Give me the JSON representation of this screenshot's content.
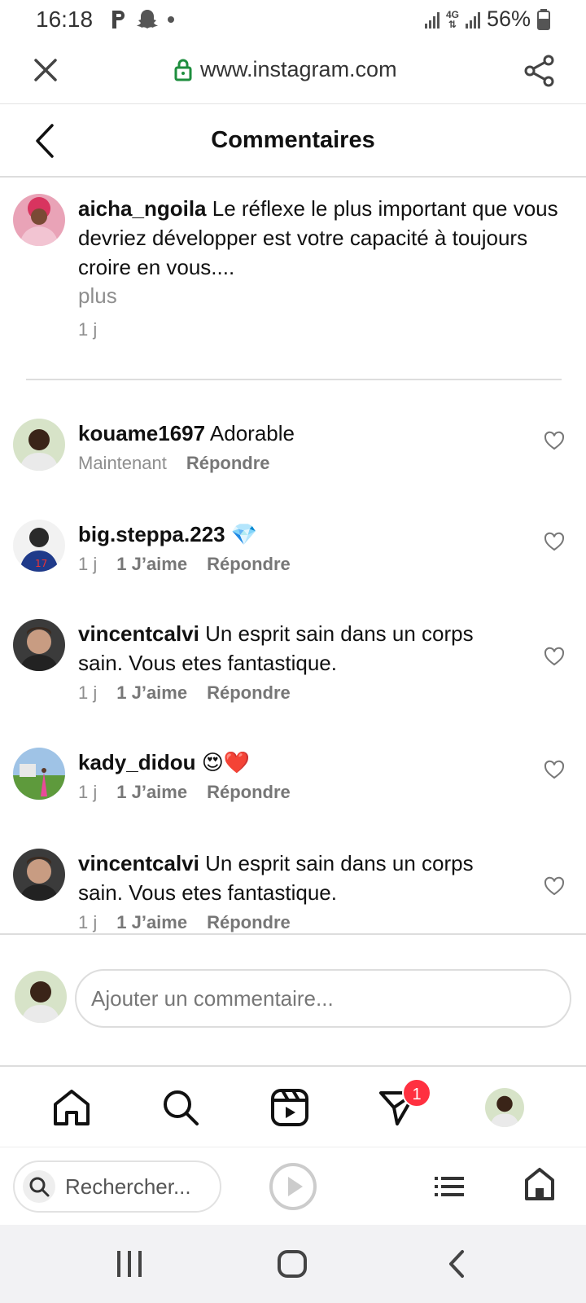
{
  "status_bar": {
    "time": "16:18",
    "icons": [
      "parking-icon",
      "snapchat-icon",
      "dot-icon"
    ],
    "network": "4G",
    "battery": "56%"
  },
  "browser": {
    "url": "www.instagram.com",
    "search_placeholder": "Rechercher..."
  },
  "header": {
    "title": "Commentaires"
  },
  "caption": {
    "username": "aicha_ngoila",
    "text": "Le réflexe le plus important que vous devriez développer est votre capacité à toujours croire en vous....",
    "more": "plus",
    "time": "1 j"
  },
  "comments": [
    {
      "username": "kouame1697",
      "text": "Adorable",
      "time": "Maintenant",
      "likes": "",
      "reply": "Répondre"
    },
    {
      "username": "big.steppa.223",
      "text": "💎",
      "time": "1 j",
      "likes": "1 J’aime",
      "reply": "Répondre"
    },
    {
      "username": "vincentcalvi",
      "text": "Un esprit sain dans un corps sain. Vous etes fantastique.",
      "time": "1 j",
      "likes": "1 J’aime",
      "reply": "Répondre"
    },
    {
      "username": "kady_didou",
      "text": "😍❤️",
      "time": "1 j",
      "likes": "1 J’aime",
      "reply": "Répondre"
    },
    {
      "username": "vincentcalvi",
      "text": "Un esprit sain dans un corps sain. Vous etes fantastique.",
      "time": "1 j",
      "likes": "1 J’aime",
      "reply": "Répondre"
    }
  ],
  "compose": {
    "placeholder": "Ajouter un commentaire..."
  },
  "nav": {
    "items": [
      "home-icon",
      "search-icon",
      "reels-icon",
      "direct-icon",
      "profile-avatar"
    ],
    "direct_badge": "1"
  },
  "colors": {
    "accent_red": "#ff3040",
    "muted_text": "#8e8e8e",
    "lock_green": "#1e8e3e"
  }
}
